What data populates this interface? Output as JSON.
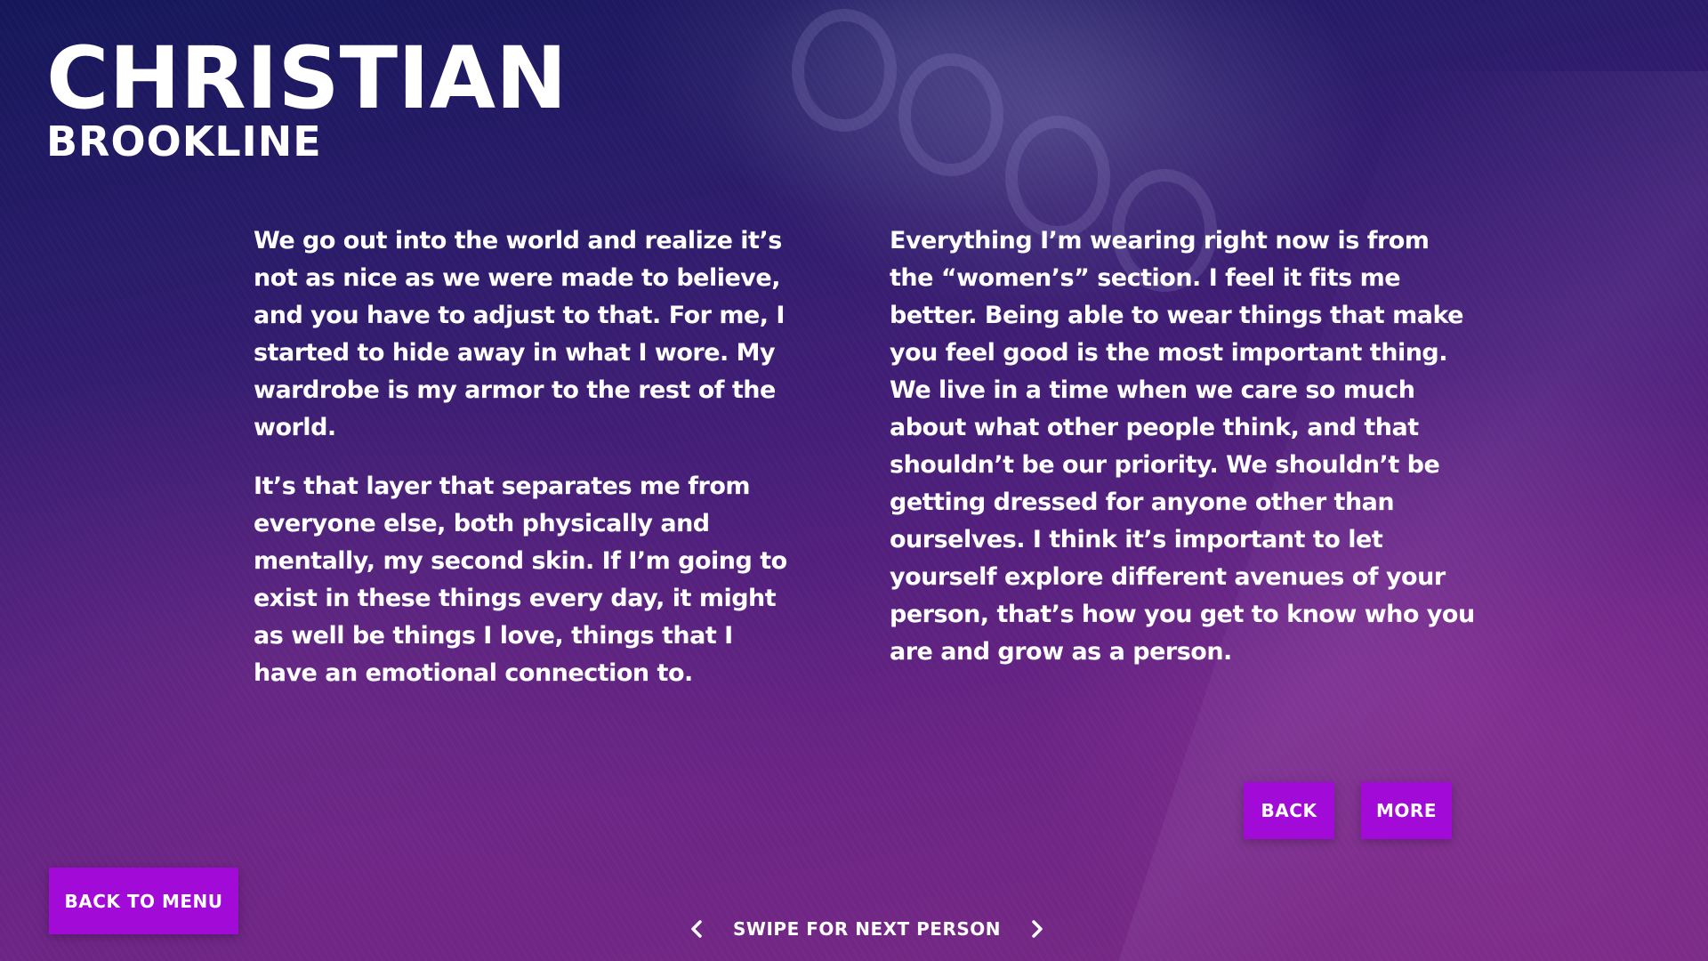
{
  "header": {
    "first_name": "CHRISTIAN",
    "last_name": "BROOKLINE"
  },
  "story": {
    "left": [
      "We go out into the world and realize it’s not as nice as we were made to believe, and you have to adjust to that. For me, I started to hide away in what I wore. My wardrobe is my armor to the rest of the world.",
      "It’s that layer that separates me from everyone else, both physically and mentally, my second skin. If I’m going to exist in these things every day, it might as well be things I love, things that I have an emotional connection to."
    ],
    "right": [
      "Everything I’m wearing right now is from the “women’s” section. I feel it fits me better. Being able to wear things that make you feel good is the most important thing. We live in a time when we care so much about what other people think, and that shouldn’t be our priority. We shouldn’t be getting dressed for anyone other than ourselves. I think it’s important to let yourself explore different avenues of your person, that’s how you get to know who you are and grow as a person."
    ]
  },
  "buttons": {
    "back": "BACK",
    "more": "MORE",
    "back_to_menu": "BACK TO MENU"
  },
  "footer": {
    "swipe_label": "SWIPE FOR NEXT PERSON",
    "prev_icon": "chevron-left-icon",
    "next_icon": "chevron-right-icon"
  },
  "colors": {
    "button_bg": "#a20ad8",
    "text": "#ffffff",
    "bg_top": "#15175a",
    "bg_bottom": "#7a2a86"
  }
}
